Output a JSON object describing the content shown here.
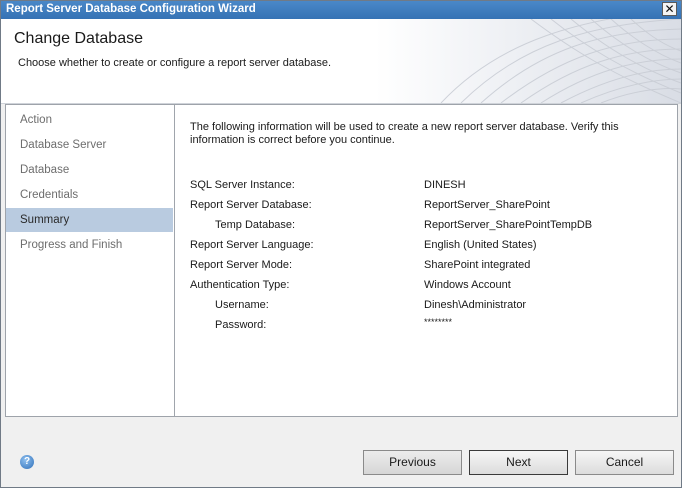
{
  "window": {
    "title": "Report Server Database Configuration Wizard"
  },
  "header": {
    "title": "Change Database",
    "subtitle": "Choose whether to create or configure a report server database."
  },
  "sidebar": {
    "items": [
      {
        "label": "Action"
      },
      {
        "label": "Database Server"
      },
      {
        "label": "Database"
      },
      {
        "label": "Credentials"
      },
      {
        "label": "Summary"
      },
      {
        "label": "Progress and Finish"
      }
    ],
    "active_index": 4
  },
  "summary": {
    "intro": "The following information will be used to create a new report server database. Verify this information is correct before you continue.",
    "rows": [
      {
        "label": "SQL Server Instance:",
        "value": "DINESH"
      },
      {
        "label": "Report Server Database:",
        "value": "ReportServer_SharePoint"
      },
      {
        "label": "Temp Database:",
        "value": "ReportServer_SharePointTempDB"
      },
      {
        "label": "Report Server Language:",
        "value": "English (United States)"
      },
      {
        "label": "Report Server Mode:",
        "value": "SharePoint integrated"
      },
      {
        "label": "Authentication Type:",
        "value": "Windows Account"
      },
      {
        "label": "Username:",
        "value": "Dinesh\\Administrator"
      },
      {
        "label": "Password:",
        "value": "********"
      }
    ]
  },
  "footer": {
    "help_icon": "help-icon",
    "previous_label": "Previous",
    "next_label": "Next",
    "cancel_label": "Cancel"
  },
  "colors": {
    "titlebar": "#3a78bb",
    "active_nav": "#b9cbe0",
    "inactive_nav_text": "#6d6d6d"
  }
}
